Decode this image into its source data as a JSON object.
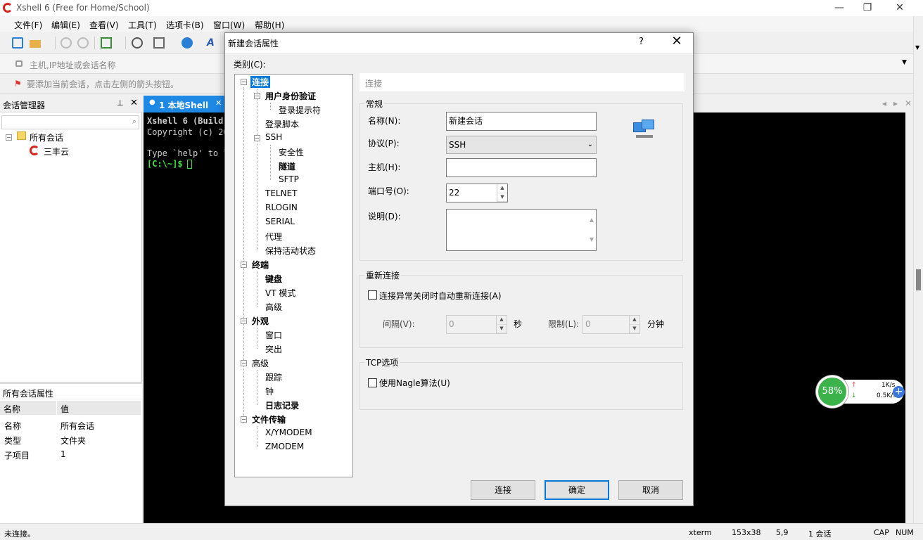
{
  "window": {
    "title": "Xshell 6 (Free for Home/School)"
  },
  "menu": [
    "文件(F)",
    "编辑(E)",
    "查看(V)",
    "工具(T)",
    "选项卡(B)",
    "窗口(W)",
    "帮助(H)"
  ],
  "address_bar": {
    "placeholder": "主机,IP地址或会话名称"
  },
  "hint_bar": {
    "text": "要添加当前会话，点击左侧的箭头按钮。"
  },
  "session_manager": {
    "title": "会话管理器",
    "tree": [
      {
        "label": "所有会话"
      },
      {
        "label": "三丰云"
      }
    ]
  },
  "properties": {
    "title": "所有会话属性",
    "columns": [
      "名称",
      "值"
    ],
    "rows": [
      {
        "name": "名称",
        "value": "所有会话"
      },
      {
        "name": "类型",
        "value": "文件夹"
      },
      {
        "name": "子项目",
        "value": "1"
      }
    ]
  },
  "tab": {
    "label": "1 本地Shell"
  },
  "terminal": {
    "lines": [
      "Xshell 6 (Build",
      "Copyright (c) 20",
      "",
      "Type `help' to l",
      "[C:\\~]$ "
    ]
  },
  "status": {
    "left": "未连接。",
    "term": "xterm",
    "size": "153x38",
    "pos": "5,9",
    "sessions": "1 会话",
    "caps": "CAP",
    "num": "NUM"
  },
  "net_widget": {
    "percent": "58%",
    "up": "1K/s",
    "down": "0.5K/s"
  },
  "dialog": {
    "title": "新建会话属性",
    "help": "?",
    "category_label": "类别(C):",
    "breadcrumb": "连接",
    "tree": [
      "连接",
      "用户身份验证",
      "登录提示符",
      "登录脚本",
      "SSH",
      "安全性",
      "隧道",
      "SFTP",
      "TELNET",
      "RLOGIN",
      "SERIAL",
      "代理",
      "保持活动状态",
      "终端",
      "键盘",
      "VT 模式",
      "高级",
      "外观",
      "窗口",
      "突出",
      "高级",
      "跟踪",
      "钟",
      "日志记录",
      "文件传输",
      "X/YMODEM",
      "ZMODEM"
    ],
    "general": {
      "title": "常规",
      "name_label": "名称(N):",
      "name_value": "新建会话",
      "protocol_label": "协议(P):",
      "protocol_value": "SSH",
      "host_label": "主机(H):",
      "host_value": "",
      "port_label": "端口号(O):",
      "port_value": "22",
      "desc_label": "说明(D):",
      "desc_value": ""
    },
    "reconnect": {
      "title": "重新连接",
      "checkbox": "连接异常关闭时自动重新连接(A)",
      "interval_label": "间隔(V):",
      "interval_value": "0",
      "interval_unit": "秒",
      "limit_label": "限制(L):",
      "limit_value": "0",
      "limit_unit": "分钟"
    },
    "tcp": {
      "title": "TCP选项",
      "checkbox": "使用Nagle算法(U)"
    },
    "buttons": {
      "connect": "连接",
      "ok": "确定",
      "cancel": "取消"
    }
  }
}
